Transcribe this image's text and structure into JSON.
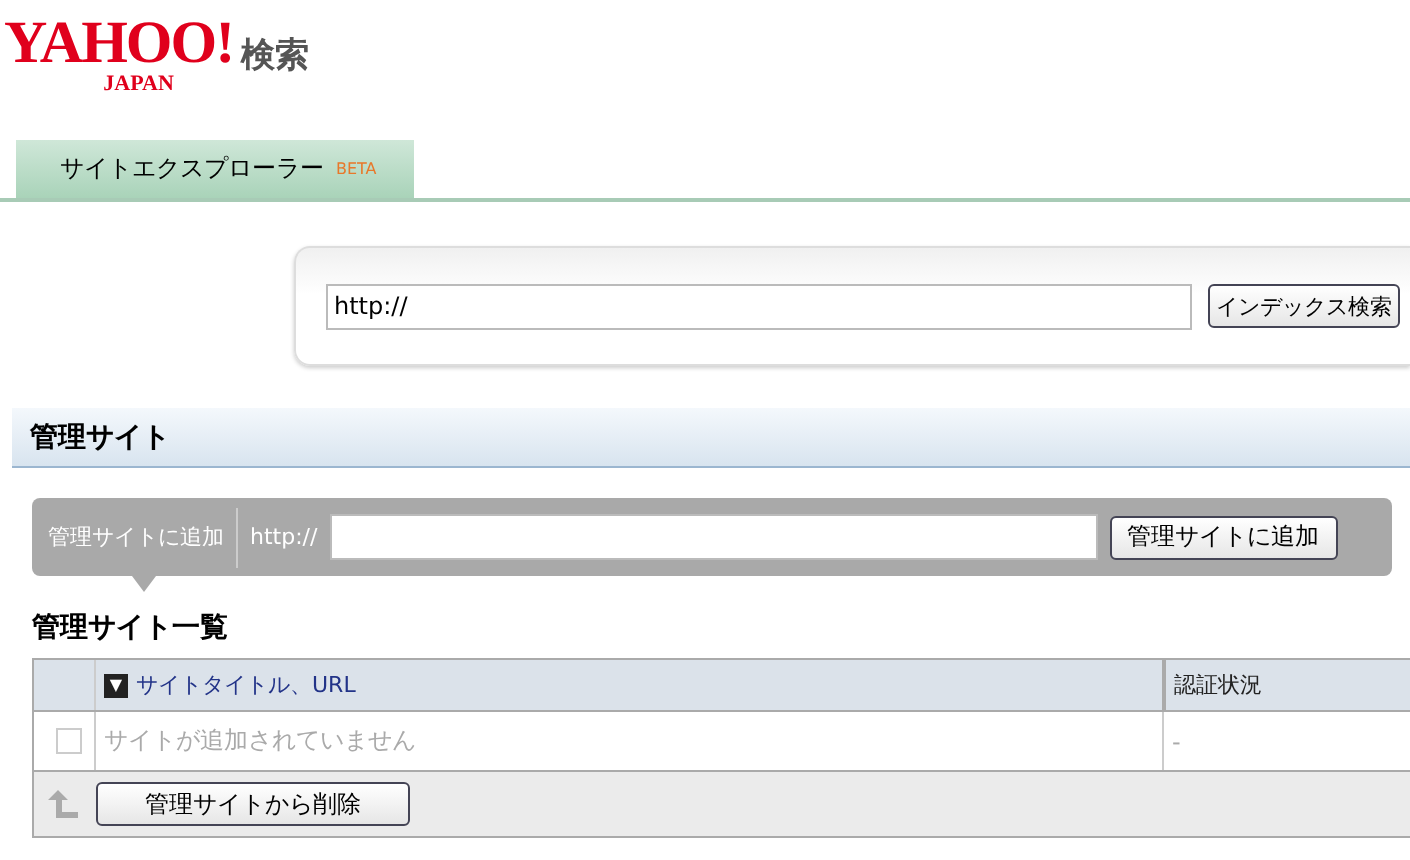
{
  "logo": {
    "brand": "YAHOO!",
    "sub": "JAPAN",
    "service": "検索"
  },
  "tabs": [
    {
      "label": "サイトエクスプローラー",
      "badge": "BETA",
      "selected": true
    }
  ],
  "search": {
    "value": "http://",
    "button": "インデックス検索"
  },
  "section": {
    "title": "管理サイト"
  },
  "add_bar": {
    "label": "管理サイトに追加",
    "prefix": "http://",
    "button": "管理サイトに追加"
  },
  "list": {
    "title": "管理サイト一覧",
    "sort_glyph": "▼",
    "columns": [
      "サイトタイトル、URL",
      "認証状況"
    ],
    "rows": [
      {
        "checked": false,
        "title": "サイトが追加されていません",
        "status": "-"
      }
    ],
    "delete_button": "管理サイトから削除"
  }
}
